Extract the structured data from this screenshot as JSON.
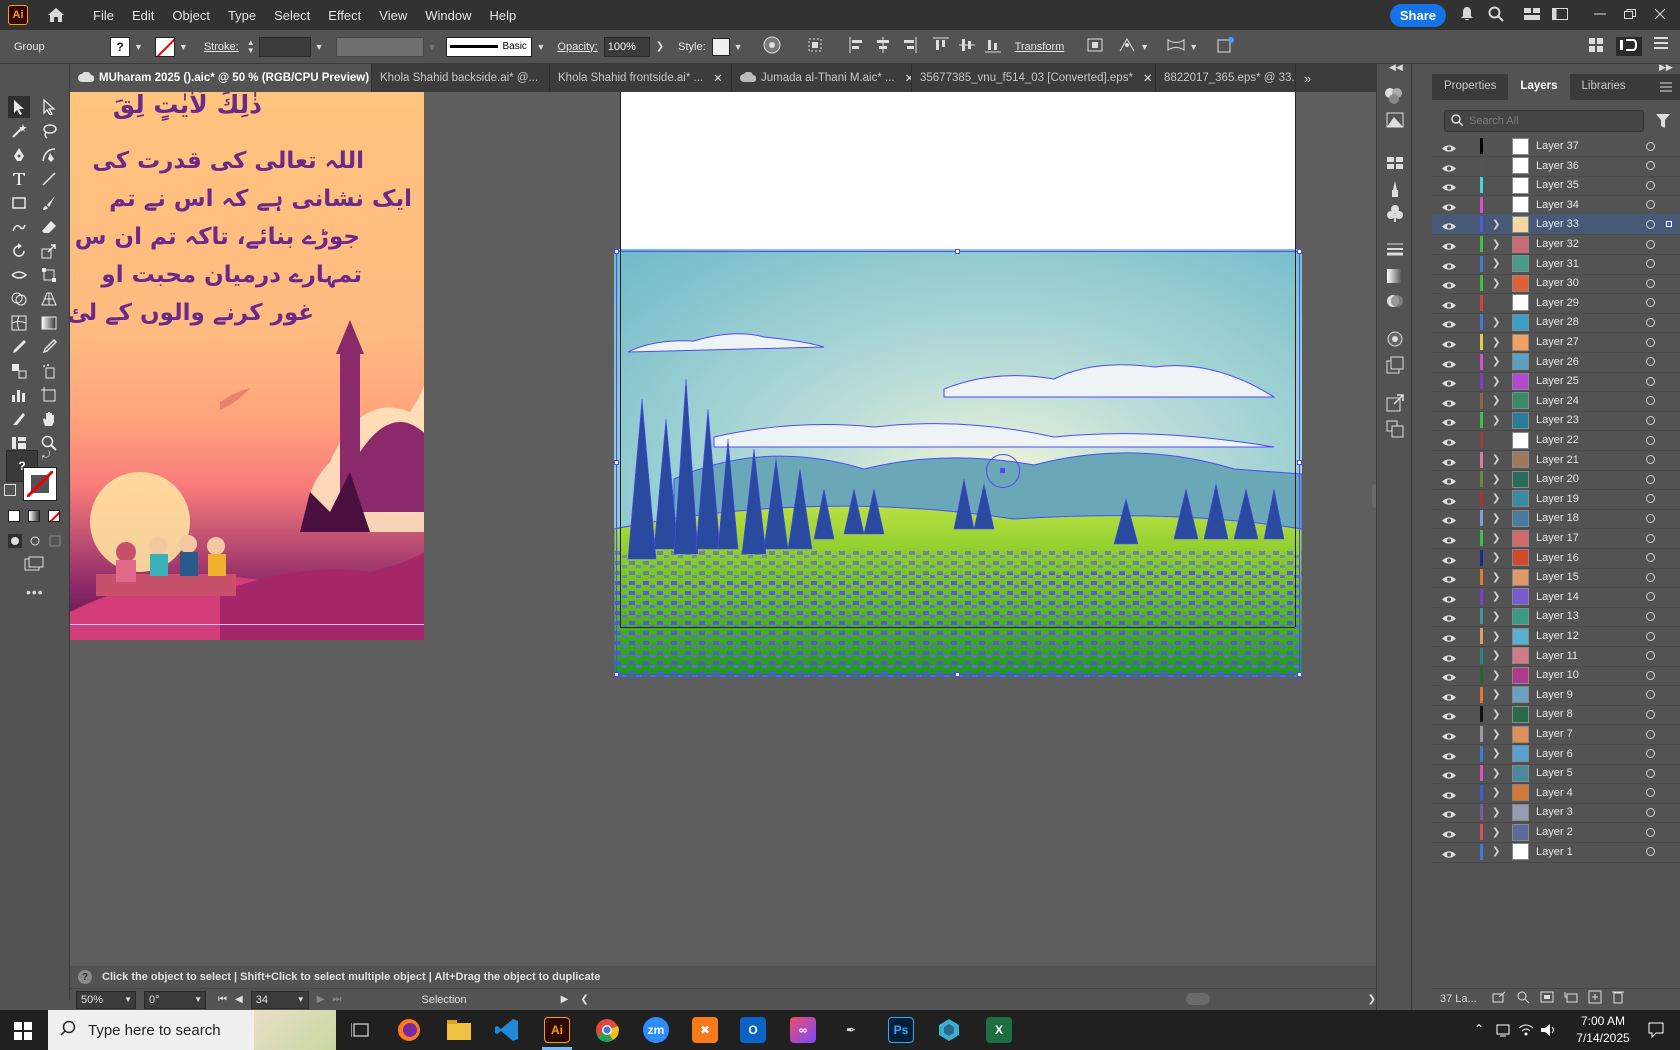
{
  "app": {
    "logo": "Ai",
    "menu": [
      "File",
      "Edit",
      "Object",
      "Type",
      "Select",
      "Effect",
      "View",
      "Window",
      "Help"
    ],
    "share_label": "Share"
  },
  "control_bar": {
    "selection_type": "Group",
    "fill_unknown": "?",
    "stroke_label": "Stroke:",
    "brush_label": "Basic",
    "opacity_label": "Opacity:",
    "opacity_value": "100%",
    "style_label": "Style:",
    "transform_label": "Transform"
  },
  "tabs": [
    {
      "label": "MUharam 2025 ().aic* @ 50 % (RGB/CPU Preview)",
      "active": true,
      "cloud": true
    },
    {
      "label": "Khola Shahid backside.ai* @...",
      "active": false,
      "cloud": false
    },
    {
      "label": "Khola Shahid frontside.ai* ...",
      "active": false,
      "cloud": false
    },
    {
      "label": "Jumada al-Thani M.aic* ...",
      "active": false,
      "cloud": true
    },
    {
      "label": "35677385_vnu_f514_03 [Converted].eps*",
      "active": false,
      "cloud": false
    },
    {
      "label": "8822017_365.eps* @ 33.3",
      "active": false,
      "cloud": false
    }
  ],
  "artboard_left": {
    "heading": "ذٰلِكَ لَاٰيٰتٍ لِقَ",
    "lines": [
      "اللہ تعالی کی قدرت کی",
      "ایک نشانی ہے کہ اس نے تم",
      "جوڑے بنائے، تاکہ تم ان س",
      "تمہارے درمیان محبت او",
      "غور کرنے والوں کے لئ"
    ]
  },
  "status": {
    "hint": "Click the object to select  |  Shift+Click to select multiple object  |  Alt+Drag the object to duplicate",
    "zoom": "50%",
    "rotation": "0°",
    "artboard_number": "34",
    "tool_name": "Selection"
  },
  "panel": {
    "tabs": [
      "Properties",
      "Layers",
      "Libraries"
    ],
    "active_tab": "Layers",
    "search_placeholder": "Search All",
    "footer_count": "37 La...",
    "layers": [
      {
        "name": "Layer 37",
        "color": "#000000",
        "expand": false,
        "thumb": "#ffffff"
      },
      {
        "name": "Layer 36",
        "color": "#555555",
        "expand": false,
        "thumb": "#ffffff"
      },
      {
        "name": "Layer 35",
        "color": "#3fd7e0",
        "expand": false,
        "thumb": "#ffffff"
      },
      {
        "name": "Layer 34",
        "color": "#d94fd0",
        "expand": false,
        "thumb": "#ffffff"
      },
      {
        "name": "Layer 33",
        "color": "#4f5fd9",
        "expand": true,
        "thumb": "#f5d9a0",
        "selected": true
      },
      {
        "name": "Layer 32",
        "color": "#39c245",
        "expand": true,
        "thumb": "#c86a7a"
      },
      {
        "name": "Layer 31",
        "color": "#3f7bd6",
        "expand": true,
        "thumb": "#4a9a8a"
      },
      {
        "name": "Layer 30",
        "color": "#39c245",
        "expand": true,
        "thumb": "#e0603a"
      },
      {
        "name": "Layer 29",
        "color": "#d93f3f",
        "expand": false,
        "thumb": "#ffffff"
      },
      {
        "name": "Layer 28",
        "color": "#3f7bd6",
        "expand": true,
        "thumb": "#3aa0c8"
      },
      {
        "name": "Layer 27",
        "color": "#e0d03f",
        "expand": true,
        "thumb": "#f0a060"
      },
      {
        "name": "Layer 26",
        "color": "#d94fd0",
        "expand": true,
        "thumb": "#5aa0c0"
      },
      {
        "name": "Layer 25",
        "color": "#7a3fd9",
        "expand": true,
        "thumb": "#b04ad0"
      },
      {
        "name": "Layer 24",
        "color": "#8a6a3f",
        "expand": true,
        "thumb": "#3a8a6a"
      },
      {
        "name": "Layer 23",
        "color": "#39c245",
        "expand": true,
        "thumb": "#2a7a9a"
      },
      {
        "name": "Layer 22",
        "color": "#9a3f3f",
        "expand": false,
        "thumb": "#ffffff"
      },
      {
        "name": "Layer 21",
        "color": "#d97aa0",
        "expand": true,
        "thumb": "#a07a5a"
      },
      {
        "name": "Layer 20",
        "color": "#6a8a3f",
        "expand": true,
        "thumb": "#2a6a5a"
      },
      {
        "name": "Layer 19",
        "color": "#b03030",
        "expand": true,
        "thumb": "#3a8aa0"
      },
      {
        "name": "Layer 18",
        "color": "#8a9ad9",
        "expand": true,
        "thumb": "#4a7aa0"
      },
      {
        "name": "Layer 17",
        "color": "#39c245",
        "expand": true,
        "thumb": "#d06a6a"
      },
      {
        "name": "Layer 16",
        "color": "#1a2a8a",
        "expand": true,
        "thumb": "#d04a2a"
      },
      {
        "name": "Layer 15",
        "color": "#e07a2a",
        "expand": true,
        "thumb": "#e09a6a"
      },
      {
        "name": "Layer 14",
        "color": "#7a3fd9",
        "expand": true,
        "thumb": "#7a5ad0"
      },
      {
        "name": "Layer 13",
        "color": "#3f9a9a",
        "expand": true,
        "thumb": "#3a9a8a"
      },
      {
        "name": "Layer 12",
        "color": "#d9a06a",
        "expand": true,
        "thumb": "#5ab0d0"
      },
      {
        "name": "Layer 11",
        "color": "#2a8a7a",
        "expand": true,
        "thumb": "#d07a8a"
      },
      {
        "name": "Layer 10",
        "color": "#1a6a2a",
        "expand": true,
        "thumb": "#b03a8a"
      },
      {
        "name": "Layer 9",
        "color": "#e07a2a",
        "expand": true,
        "thumb": "#6aa0c0"
      },
      {
        "name": "Layer 8",
        "color": "#111111",
        "expand": true,
        "thumb": "#2a6a4a"
      },
      {
        "name": "Layer 7",
        "color": "#9a9a9a",
        "expand": true,
        "thumb": "#e0905a"
      },
      {
        "name": "Layer 6",
        "color": "#3f7bd6",
        "expand": true,
        "thumb": "#5aa0d0"
      },
      {
        "name": "Layer 5",
        "color": "#d94fd0",
        "expand": true,
        "thumb": "#4a8a9a"
      },
      {
        "name": "Layer 4",
        "color": "#3f5fd9",
        "expand": true,
        "thumb": "#d07a3a"
      },
      {
        "name": "Layer 3",
        "color": "#7a5aa0",
        "expand": true,
        "thumb": "#9a9ab0"
      },
      {
        "name": "Layer 2",
        "color": "#d94f5f",
        "expand": true,
        "thumb": "#5a6a9a"
      },
      {
        "name": "Layer 1",
        "color": "#3f7bd6",
        "expand": true,
        "thumb": "#ffffff"
      }
    ]
  },
  "taskbar": {
    "search_placeholder": "Type here to search",
    "time": "7:00 AM",
    "date": "7/14/2025",
    "apps": [
      "Task View",
      "Firefox",
      "File Explorer",
      "VS Code",
      "Illustrator",
      "Chrome",
      "Zoom",
      "XAMPP",
      "Outlook",
      "Creative Cloud",
      "Inkscape",
      "Photoshop",
      "App",
      "Excel"
    ]
  },
  "colors": {
    "selection": "#4a4aff",
    "accent": "#1473e6"
  }
}
